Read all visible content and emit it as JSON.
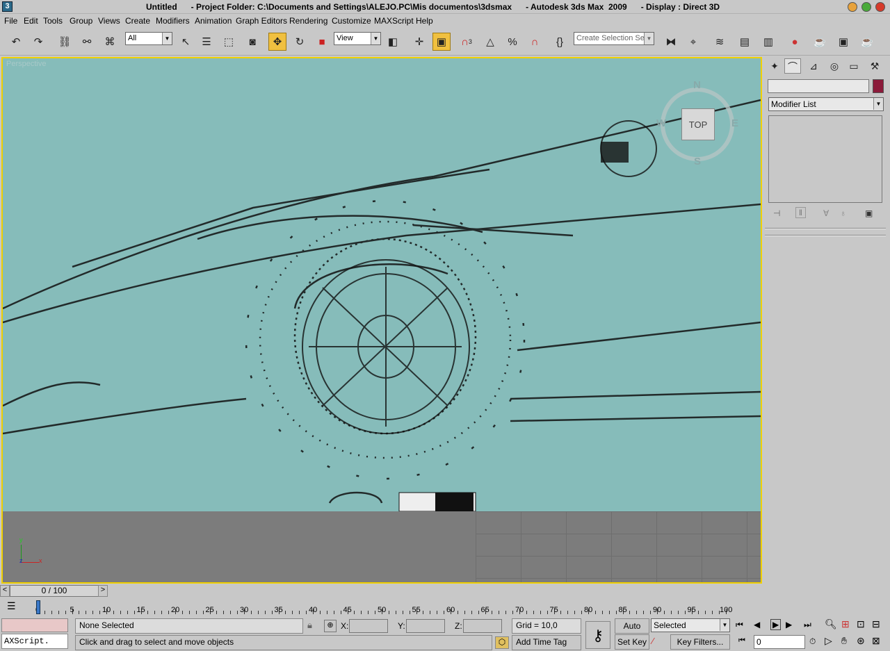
{
  "titlebar": {
    "title": "Untitled      - Project Folder: C:\\Documents and Settings\\ALEJO.PC\\Mis documentos\\3dsmax      - Autodesk 3ds Max  2009      - Display : Direct 3D",
    "app_icon": "3"
  },
  "menu": [
    "File",
    "Edit",
    "Tools",
    "Group",
    "Views",
    "Create",
    "Modifiers",
    "Animation",
    "Graph Editors",
    "Rendering",
    "Customize",
    "MAXScript",
    "Help"
  ],
  "toolbar": {
    "filter_value": "All",
    "coord_value": "View",
    "named_selection_placeholder": "Create Selection Set",
    "snap_label": "3"
  },
  "viewport": {
    "label": "Perspective",
    "viewcube": {
      "face": "TOP",
      "north": "N",
      "south": "S",
      "east": "E",
      "west": "W"
    },
    "axis": {
      "x": "x",
      "y": "y",
      "z": "z"
    }
  },
  "command_panel": {
    "modifier_list": "Modifier List",
    "object_color": "#8b1a3a"
  },
  "timeline": {
    "frame_display": "0 / 100",
    "prev_icon": "<",
    "next_icon": ">",
    "ticks": [
      "0",
      "5",
      "10",
      "15",
      "20",
      "25",
      "30",
      "35",
      "40",
      "45",
      "50",
      "55",
      "60",
      "65",
      "70",
      "75",
      "80",
      "85",
      "90",
      "95",
      "100"
    ]
  },
  "status": {
    "maxscript_listener": "AXScript.",
    "selection_status": "None Selected",
    "prompt": "Click and drag to select and move objects",
    "x_label": "X:",
    "y_label": "Y:",
    "z_label": "Z:",
    "grid": "Grid = 10,0",
    "add_time_tag": "Add Time Tag",
    "auto_key": "Auto Key",
    "set_key": "Set Key",
    "key_mode": "Selected",
    "key_filters": "Key Filters...",
    "current_frame": "0"
  }
}
